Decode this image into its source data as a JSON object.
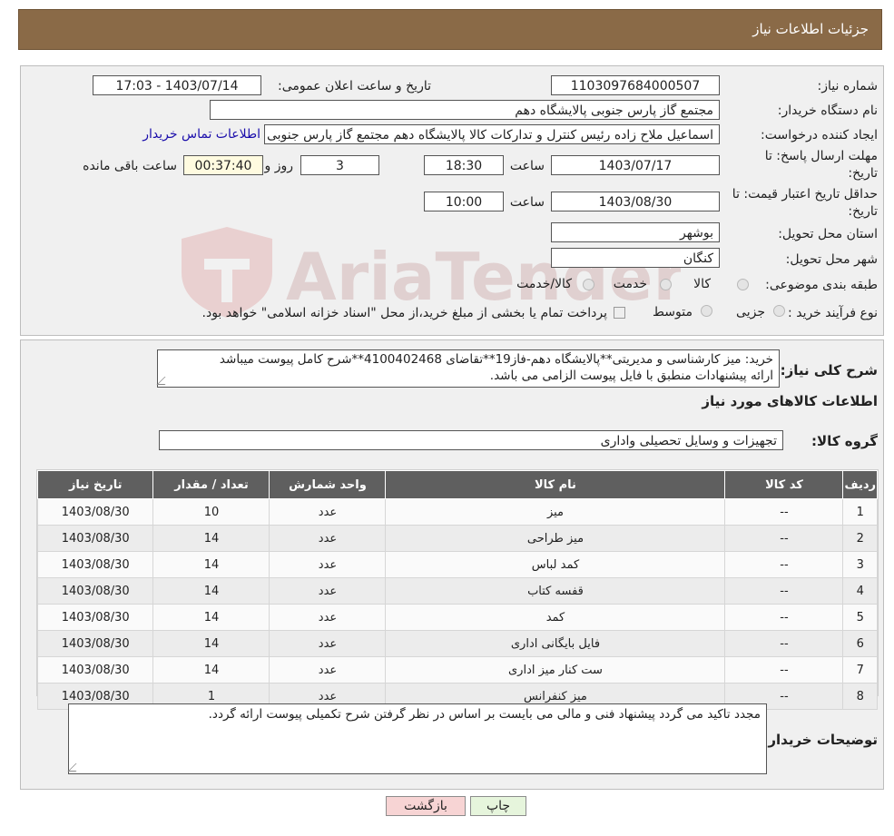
{
  "header": {
    "title": "جزئیات اطلاعات نیاز"
  },
  "info": {
    "need_number_label": "شماره نیاز:",
    "need_number": "1103097684000507",
    "announce_label": "تاریخ و ساعت اعلان عمومی:",
    "announce_value": "1403/07/14 - 17:03",
    "buyer_org_label": "نام دستگاه خریدار:",
    "buyer_org": "مجتمع گاز پارس جنوبی  پالایشگاه دهم",
    "requester_label": "ایجاد کننده درخواست:",
    "requester": "اسماعیل ملاح زاده رئیس کنترل و تدارکات کالا پالایشگاه دهم مجتمع گاز پارس جنوبی",
    "contact_link": "اطلاعات تماس خریدار",
    "deadline_label_1": "مهلت ارسال پاسخ: تا",
    "deadline_label_2": "تاریخ:",
    "deadline_date": "1403/07/17",
    "time_label": "ساعت",
    "deadline_time": "18:30",
    "days": "3",
    "days_label": "روز و",
    "remaining": "00:37:40",
    "remaining_label": "ساعت باقی مانده",
    "validity_label_1": "حداقل تاریخ اعتبار قیمت: تا",
    "validity_label_2": "تاریخ:",
    "validity_date": "1403/08/30",
    "validity_time": "10:00",
    "province_label": "استان محل تحویل:",
    "province": "بوشهر",
    "city_label": "شهر محل تحویل:",
    "city": "کنگان",
    "category_label": "طبقه بندی موضوعی:",
    "category_options": [
      "کالا",
      "خدمت",
      "کالا/خدمت"
    ],
    "purchase_type_label": "نوع فرآیند خرید :",
    "purchase_options": [
      "جزیی",
      "متوسط"
    ],
    "payment_note": "پرداخت تمام یا بخشی از مبلغ خرید،از محل \"اسناد خزانه اسلامی\" خواهد بود."
  },
  "watermark": {
    "text": "AriaTender.neT"
  },
  "description": {
    "label": "شرح کلی نیاز:",
    "text_line1": "خرید: میز کارشناسی و مدیریتی**پالایشگاه دهم-فاز19**تقاضای 4100402468**شرح کامل پیوست میباشد",
    "text_line2": "ارائه پیشنهادات  منطبق با فایل پیوست الزامی می باشد."
  },
  "goods": {
    "section_title": "اطلاعات کالاهای مورد نیاز",
    "group_label": "گروه کالا:",
    "group_value": "تجهیزات و وسایل تحصیلی واداری",
    "columns": [
      "ردیف",
      "کد کالا",
      "نام کالا",
      "واحد شمارش",
      "تعداد / مقدار",
      "تاریخ نیاز"
    ],
    "rows": [
      [
        "1",
        "--",
        "میز",
        "عدد",
        "10",
        "1403/08/30"
      ],
      [
        "2",
        "--",
        "میز طراحی",
        "عدد",
        "14",
        "1403/08/30"
      ],
      [
        "3",
        "--",
        "کمد لباس",
        "عدد",
        "14",
        "1403/08/30"
      ],
      [
        "4",
        "--",
        "قفسه کتاب",
        "عدد",
        "14",
        "1403/08/30"
      ],
      [
        "5",
        "--",
        "کمد",
        "عدد",
        "14",
        "1403/08/30"
      ],
      [
        "6",
        "--",
        "فایل بایگانی اداری",
        "عدد",
        "14",
        "1403/08/30"
      ],
      [
        "7",
        "--",
        "ست کنار میز اداری",
        "عدد",
        "14",
        "1403/08/30"
      ],
      [
        "8",
        "--",
        "میز کنفرانس",
        "عدد",
        "1",
        "1403/08/30"
      ]
    ]
  },
  "buyer_notes": {
    "label": "توضیحات خریدار:",
    "text": "مجدد تاکید می گردد پیشنهاد فنی و مالی می بایست بر اساس در نظر گرفتن شرح تکمیلی پیوست ارائه گردد."
  },
  "buttons": {
    "print": "چاپ",
    "back": "بازگشت"
  },
  "colors": {
    "header_bg": "#8a6a47",
    "table_header_bg": "#5f5f5f",
    "link": "#1a0dab",
    "back_btn": "#f7d4d4",
    "print_btn": "#e6f5dc"
  }
}
